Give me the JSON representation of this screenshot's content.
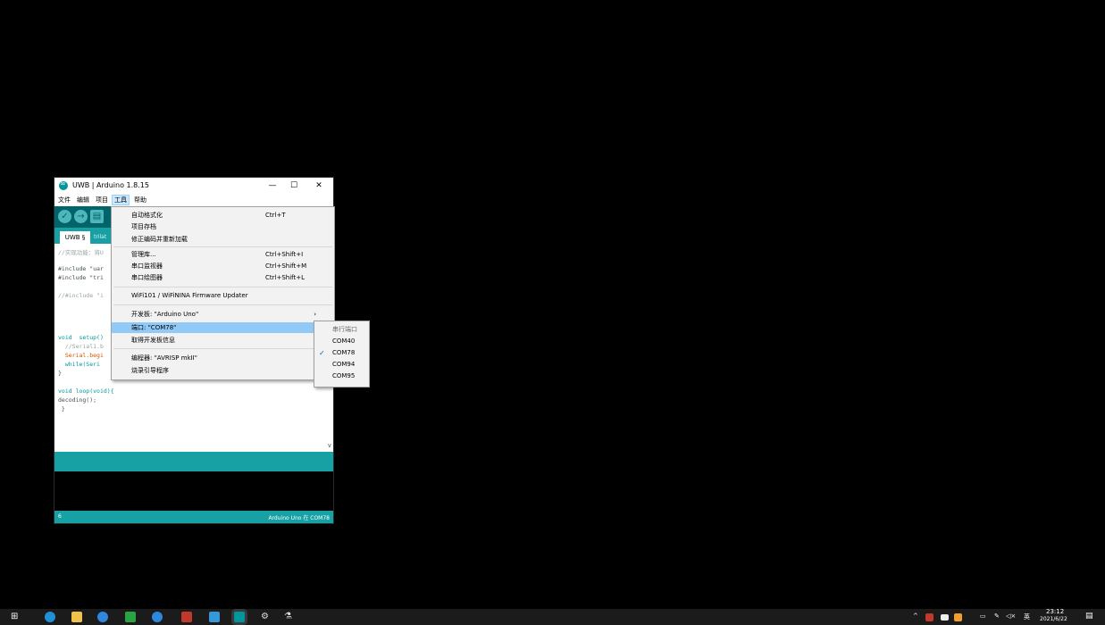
{
  "window": {
    "title": "UWB | Arduino 1.8.15",
    "minimize": "—",
    "maximize": "☐",
    "close": "✕"
  },
  "menubar": [
    "文件",
    "编辑",
    "项目",
    "工具",
    "帮助"
  ],
  "tabs": {
    "active": "UWB §",
    "second": "trilat"
  },
  "code_lines": [
    "//实现功能：将U",
    "#include \"uar",
    "#include \"tri",
    "//#include \"i",
    "void  setup()",
    "  //Serial1.b",
    "  Serial.begi",
    "  while(Seri",
    "}",
    "void loop(void){",
    "decoding();",
    " }"
  ],
  "status": {
    "line": "6",
    "board": "Arduino Uno 在 COM78"
  },
  "tools_menu": [
    {
      "label": "自动格式化",
      "shortcut": "Ctrl+T"
    },
    {
      "label": "项目存档",
      "shortcut": ""
    },
    {
      "label": "修正编码并重新加载",
      "shortcut": ""
    },
    {
      "label": "管理库...",
      "shortcut": "Ctrl+Shift+I"
    },
    {
      "label": "串口监视器",
      "shortcut": "Ctrl+Shift+M"
    },
    {
      "label": "串口绘图器",
      "shortcut": "Ctrl+Shift+L"
    },
    {
      "label": "WiFi101 / WiFiNINA Firmware Updater",
      "shortcut": ""
    },
    {
      "label": "开发板: \"Arduino Uno\"",
      "shortcut": ""
    },
    {
      "label": "端口: \"COM78\"",
      "shortcut": ""
    },
    {
      "label": "取得开发板信息",
      "shortcut": ""
    },
    {
      "label": "编程器: \"AVRISP mkII\"",
      "shortcut": ""
    },
    {
      "label": "烧录引导程序",
      "shortcut": ""
    }
  ],
  "port_menu": {
    "header": "串行端口",
    "ports": [
      "COM40",
      "COM78",
      "COM94",
      "COM95"
    ],
    "selected": "COM78"
  },
  "taskbar": {
    "time": "23:12",
    "date": "2021/6/22",
    "ime": "英"
  },
  "colors": {
    "arduino_teal": "#00979c",
    "arduino_dark": "#006468",
    "highlight": "#91c9f7"
  }
}
